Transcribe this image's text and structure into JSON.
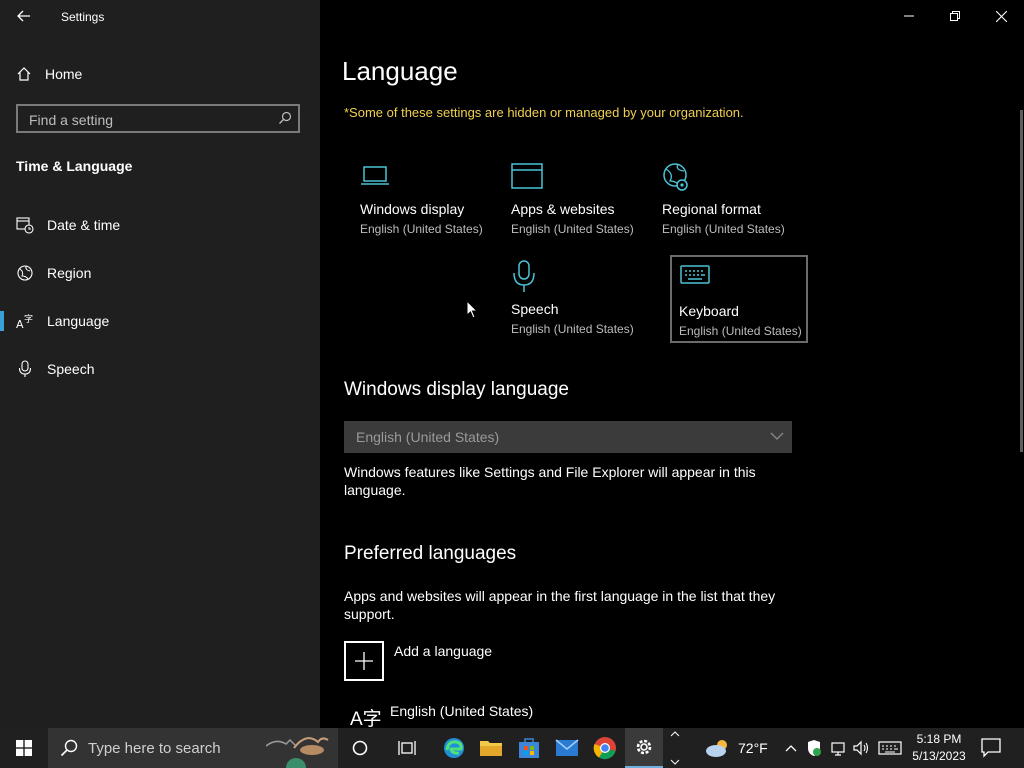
{
  "window": {
    "title": "Settings"
  },
  "sidebar": {
    "home_label": "Home",
    "search_placeholder": "Find a setting",
    "section_title": "Time & Language",
    "items": [
      {
        "label": "Date & time",
        "icon": "calendar-clock-icon"
      },
      {
        "label": "Region",
        "icon": "globe-icon"
      },
      {
        "label": "Language",
        "icon": "language-icon",
        "selected": true
      },
      {
        "label": "Speech",
        "icon": "microphone-icon"
      }
    ]
  },
  "main": {
    "title": "Language",
    "notice": "*Some of these settings are hidden or managed by your organization.",
    "tiles": [
      {
        "name": "Windows display",
        "sub": "English (United States)",
        "icon": "laptop-icon"
      },
      {
        "name": "Apps & websites",
        "sub": "English (United States)",
        "icon": "window-icon"
      },
      {
        "name": "Regional format",
        "sub": "English (United States)",
        "icon": "globe-gear-icon"
      },
      {
        "name": "Keyboard",
        "sub": "English (United States)",
        "icon": "keyboard-icon"
      },
      {
        "name": "Speech",
        "sub": "English (United States)",
        "icon": "microphone-icon"
      }
    ],
    "display_language": {
      "heading": "Windows display language",
      "selected": "English (United States)",
      "description": "Windows features like Settings and File Explorer will appear in this language."
    },
    "preferred": {
      "heading": "Preferred languages",
      "description": "Apps and websites will appear in the first language in the list that they support.",
      "add_label": "Add a language",
      "languages": [
        {
          "label": "English (United States)",
          "glyph": "A字"
        }
      ]
    }
  },
  "taskbar": {
    "search_placeholder": "Type here to search",
    "weather_temp": "72°F",
    "time": "5:18 PM",
    "date": "5/13/2023"
  },
  "colors": {
    "accent": "#3aa0d8",
    "notice": "#f0d050",
    "sidebar_bg": "#1f1f1f",
    "icon_teal": "#4cc2d6"
  }
}
